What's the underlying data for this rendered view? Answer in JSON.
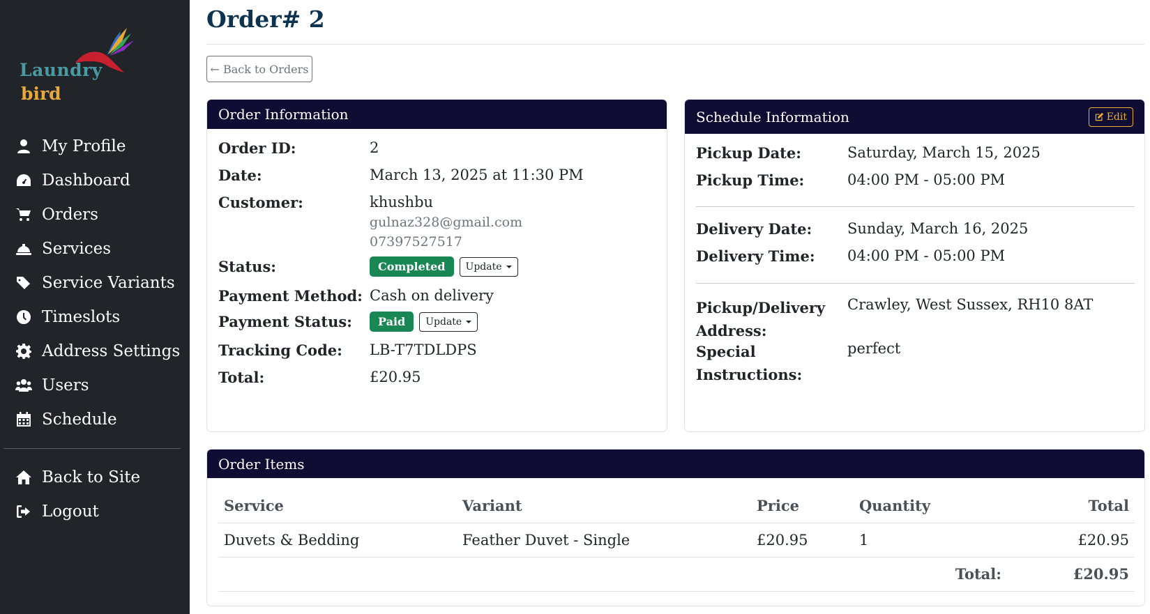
{
  "brand": {
    "line1": "Laundry",
    "line2": "bird",
    "colors": {
      "teal": "#4a9aa3",
      "gold": "#e9a93a",
      "bird": "#c8202f"
    }
  },
  "sidebar": {
    "items": [
      {
        "label": "My Profile",
        "icon": "user-icon"
      },
      {
        "label": "Dashboard",
        "icon": "gauge-icon"
      },
      {
        "label": "Orders",
        "icon": "cart-icon"
      },
      {
        "label": "Services",
        "icon": "bell-icon"
      },
      {
        "label": "Service Variants",
        "icon": "tags-icon"
      },
      {
        "label": "Timeslots",
        "icon": "clock-icon"
      },
      {
        "label": "Address Settings",
        "icon": "gear-icon"
      },
      {
        "label": "Users",
        "icon": "users-icon"
      },
      {
        "label": "Schedule",
        "icon": "calendar-icon"
      }
    ],
    "bottom": [
      {
        "label": "Back to Site",
        "icon": "home-icon"
      },
      {
        "label": "Logout",
        "icon": "logout-icon"
      }
    ]
  },
  "page": {
    "title": "Order# 2",
    "back_label": "Back to Orders"
  },
  "order_info": {
    "header": "Order Information",
    "order_id_label": "Order ID:",
    "order_id": "2",
    "date_label": "Date:",
    "date": "March 13, 2025 at 11:30 PM",
    "customer_label": "Customer:",
    "customer_name": "khushbu",
    "customer_email": "gulnaz328@gmail.com",
    "customer_phone": "07397527517",
    "status_label": "Status:",
    "status": "Completed",
    "update_label": "Update",
    "payment_method_label": "Payment Method:",
    "payment_method": "Cash on delivery",
    "payment_status_label": "Payment Status:",
    "payment_status": "Paid",
    "tracking_label": "Tracking Code:",
    "tracking": "LB-T7TDLDPS",
    "total_label": "Total:",
    "total": "£20.95"
  },
  "schedule_info": {
    "header": "Schedule Information",
    "edit_label": "Edit",
    "pickup_date_label": "Pickup Date:",
    "pickup_date": "Saturday, March 15, 2025",
    "pickup_time_label": "Pickup Time:",
    "pickup_time": "04:00 PM - 05:00 PM",
    "delivery_date_label": "Delivery Date:",
    "delivery_date": "Sunday, March 16, 2025",
    "delivery_time_label": "Delivery Time:",
    "delivery_time": "04:00 PM - 05:00 PM",
    "address_label_1": "Pickup/Delivery",
    "address_label_2": "Address:",
    "address": "Crawley, West Sussex, RH10 8AT",
    "instructions_label_1": "Special",
    "instructions_label_2": "Instructions:",
    "instructions": "perfect"
  },
  "order_items": {
    "header": "Order Items",
    "columns": {
      "service": "Service",
      "variant": "Variant",
      "price": "Price",
      "quantity": "Quantity",
      "total": "Total"
    },
    "rows": [
      {
        "service": "Duvets & Bedding",
        "variant": "Feather Duvet - Single",
        "price": "£20.95",
        "quantity": "1",
        "total": "£20.95"
      }
    ],
    "total_label": "Total:",
    "total": "£20.95"
  }
}
